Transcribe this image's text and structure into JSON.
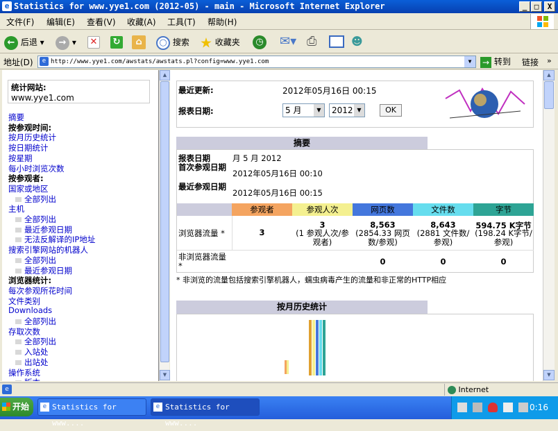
{
  "window": {
    "title": "Statistics for www.yye1.com (2012-05) - main - Microsoft Internet Explorer",
    "btn_min": "_",
    "btn_max": "□",
    "btn_close": "X"
  },
  "menu": [
    "文件(F)",
    "编辑(E)",
    "查看(V)",
    "收藏(A)",
    "工具(T)",
    "帮助(H)"
  ],
  "toolbar": {
    "back": "后退",
    "search": "搜索",
    "favorites": "收藏夹"
  },
  "address": {
    "label": "地址(D)",
    "url": "http://www.yye1.com/awstats/awstats.pl?config=www.yye1.com",
    "go": "转到",
    "links": "链接"
  },
  "left": {
    "site_label": "统计网站:",
    "site": "www.yye1.com",
    "items": [
      {
        "t": "摘要",
        "k": "l"
      },
      {
        "t": "按参观时间:",
        "k": "b"
      },
      {
        "t": "按月历史统计",
        "k": "l"
      },
      {
        "t": "按日期统计",
        "k": "l"
      },
      {
        "t": "按星期",
        "k": "l"
      },
      {
        "t": "每小时浏览次数",
        "k": "l"
      },
      {
        "t": "按参观者:",
        "k": "b"
      },
      {
        "t": "国家或地区",
        "k": "l"
      },
      {
        "t": "全部列出",
        "k": "s"
      },
      {
        "t": "主机",
        "k": "l"
      },
      {
        "t": "全部列出",
        "k": "s"
      },
      {
        "t": "最近参观日期",
        "k": "s"
      },
      {
        "t": "无法反解译的IP地址",
        "k": "s"
      },
      {
        "t": "搜索引擎网站的机器人",
        "k": "l"
      },
      {
        "t": "全部列出",
        "k": "s"
      },
      {
        "t": "最近参观日期",
        "k": "s"
      },
      {
        "t": "浏览器统计:",
        "k": "b"
      },
      {
        "t": "每次参观所花时间",
        "k": "l"
      },
      {
        "t": "文件类别",
        "k": "l"
      },
      {
        "t": "Downloads",
        "k": "l"
      },
      {
        "t": "全部列出",
        "k": "s"
      },
      {
        "t": "存取次数",
        "k": "l"
      },
      {
        "t": "全部列出",
        "k": "s"
      },
      {
        "t": "入站处",
        "k": "s"
      },
      {
        "t": "出站处",
        "k": "s"
      },
      {
        "t": "操作系统",
        "k": "l"
      },
      {
        "t": "版本",
        "k": "s"
      }
    ]
  },
  "right": {
    "last_update_label": "最近更新:",
    "last_update": "2012年05月16日 00:15",
    "report_date_label": "报表日期:",
    "month_sel": "5 月",
    "year_sel": "2012",
    "ok": "OK",
    "summary_title": "摘要",
    "sum_report_label": "报表日期",
    "sum_report_val": "月 5 月 2012",
    "first_label": "首次参观日期",
    "first_val": "2012年05月16日 00:10",
    "last_label": "最近参观日期",
    "last_val": "2012年05月16日 00:15",
    "cols": [
      "参观者",
      "参观人次",
      "网页数",
      "文件数",
      "字节"
    ],
    "browser_label": "浏览器流量 *",
    "browser": [
      "3",
      "3",
      "8,563",
      "8,643",
      "594.75 K字节"
    ],
    "browser_sub": [
      "",
      "(1 参观人次/参观者)",
      "(2854.33 网页数/参观)",
      "(2881 文件数/参观)",
      "(198.24 K字节/参观)"
    ],
    "nonbrowser_label": "非浏览器流量 *",
    "nonbrowser": [
      "",
      "",
      "0",
      "0",
      "0"
    ],
    "note": "* 非浏览的流量包括搜索引擎机器人，蠕虫病毒产生的流量和非正常的HTTP相应",
    "monthly_title": "按月历史统计"
  },
  "status": {
    "zone": "Internet"
  },
  "taskbar": {
    "start": "开始",
    "task1": "Statistics for www....",
    "task2": "Statistics for www....",
    "clock": "0:16"
  },
  "colors": {
    "visitors": "#f4a460",
    "visits": "#f4f090",
    "pages": "#4477dd",
    "hits": "#66ddee",
    "bytes": "#2ea495",
    "header": "#ccccdd"
  }
}
